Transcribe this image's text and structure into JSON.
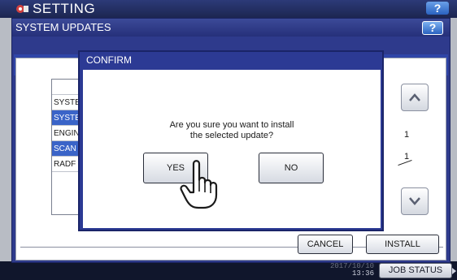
{
  "background": {
    "title": "SETTING",
    "help_label": "?",
    "clock_line1": "2017/10/10",
    "clock_line2": "13:36",
    "job_status_label": "JOB STATUS"
  },
  "panel": {
    "title": "SYSTEM UPDATES",
    "help_label": "?",
    "list": [
      {
        "label": "",
        "selected": false
      },
      {
        "label": "SYSTE",
        "selected": false
      },
      {
        "label": "SYSTE",
        "selected": true
      },
      {
        "label": "ENGIN",
        "selected": false
      },
      {
        "label": "SCAN",
        "selected": true
      },
      {
        "label": "RADF",
        "selected": false
      }
    ],
    "page_current": "1",
    "page_total": "1",
    "cancel_label": "CANCEL",
    "install_label": "INSTALL"
  },
  "dialog": {
    "title": "CONFIRM",
    "message_line1": "Are you sure you want to install",
    "message_line2": "the selected update?",
    "yes_label": "YES",
    "no_label": "NO"
  },
  "colors": {
    "header_blue": "#2e3a8c",
    "selection_blue": "#3a64c8"
  },
  "icons": [
    "settings-icon",
    "scroll-up-icon",
    "scroll-down-icon",
    "pointer-hand-icon"
  ]
}
